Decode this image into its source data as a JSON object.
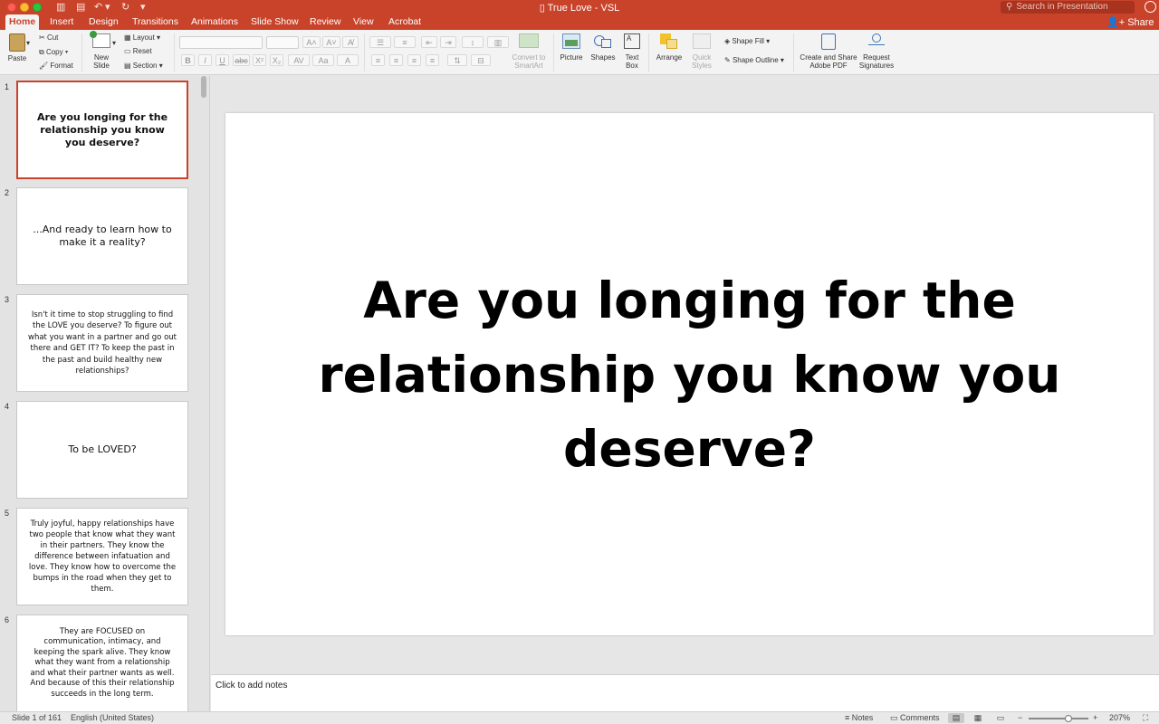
{
  "window": {
    "title": "True Love - VSL",
    "search_placeholder": "Search in Presentation",
    "share_label": "Share"
  },
  "tabs": [
    "Home",
    "Insert",
    "Design",
    "Transitions",
    "Animations",
    "Slide Show",
    "Review",
    "View",
    "Acrobat"
  ],
  "active_tab": "Home",
  "ribbon": {
    "paste": "Paste",
    "cut": "Cut",
    "copy": "Copy",
    "format": "Format",
    "new_slide_line1": "New",
    "new_slide_line2": "Slide",
    "layout": "Layout",
    "reset": "Reset",
    "section": "Section",
    "convert_line1": "Convert to",
    "convert_line2": "SmartArt",
    "picture": "Picture",
    "shapes": "Shapes",
    "textbox_line1": "Text",
    "textbox_line2": "Box",
    "arrange": "Arrange",
    "quick_styles_line1": "Quick",
    "quick_styles_line2": "Styles",
    "shape_fill": "Shape Fill",
    "shape_outline": "Shape Outline",
    "create_share_line1": "Create and Share",
    "create_share_line2": "Adobe PDF",
    "request_line1": "Request",
    "request_line2": "Signatures"
  },
  "thumbnails": [
    {
      "num": "1",
      "text": "Are you longing for the relationship you know you deserve?"
    },
    {
      "num": "2",
      "text": "...And ready to learn how to make it a reality?"
    },
    {
      "num": "3",
      "text": "Isn't it time to stop struggling to find the LOVE you deserve? To figure out what you want in a partner and go out there and GET IT? To keep the past in the past and build healthy new relationships?"
    },
    {
      "num": "4",
      "text": "To be LOVED?"
    },
    {
      "num": "5",
      "text": "Truly joyful, happy relationships have two people that know what they want in their partners. They know the difference between infatuation and love. They know how to overcome the bumps in the road when they get to them."
    },
    {
      "num": "6",
      "text": "They are FOCUSED on communication, intimacy, and keeping the spark alive. They know what they want from a relationship and what their partner wants as well. And because of this their relationship succeeds in the long term."
    }
  ],
  "slide": {
    "title": "Are you longing for the relationship you know you deserve?"
  },
  "notes_placeholder": "Click to add notes",
  "status": {
    "slide_info": "Slide 1 of 161",
    "language": "English (United States)",
    "notes": "Notes",
    "comments": "Comments",
    "zoom": "207%"
  }
}
